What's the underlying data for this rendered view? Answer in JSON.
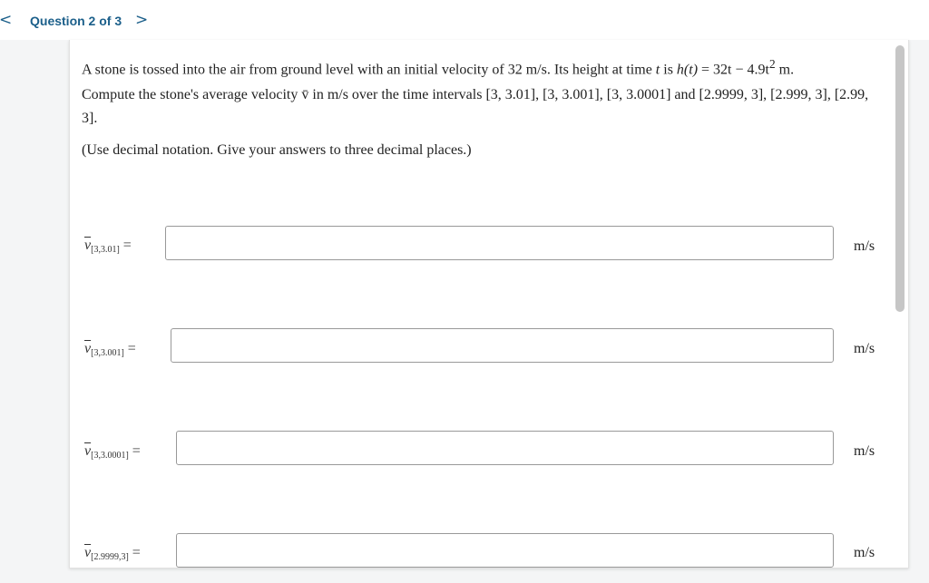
{
  "nav": {
    "prev_glyph": "<",
    "title": "Question 2 of 3",
    "next_glyph": ">"
  },
  "question": {
    "paragraph1_pre": "A stone is tossed into the air from ground level with an initial velocity of 32 m/s. Its height at time ",
    "t_var": "t",
    "is": " is ",
    "h_func": "h(t)",
    "eq_rhs": " = 32t − 4.9t",
    "exp": "2",
    "unit_end": " m.",
    "paragraph2": "Compute the stone's average velocity v̄ in m/s over the time intervals [3, 3.01], [3, 3.001], [3, 3.0001] and [2.9999, 3], [2.999, 3], [2.99, 3].",
    "paragraph3": "(Use decimal notation. Give your answers to three decimal places.)"
  },
  "rows": [
    {
      "var": "v",
      "interval": "[3,3.01]",
      "equals": "=",
      "value": "",
      "unit": "m/s"
    },
    {
      "var": "v",
      "interval": "[3,3.001]",
      "equals": "=",
      "value": "",
      "unit": "m/s"
    },
    {
      "var": "v",
      "interval": "[3,3.0001]",
      "equals": "=",
      "value": "",
      "unit": "m/s"
    },
    {
      "var": "v",
      "interval": "[2.9999,3]",
      "equals": "=",
      "value": "",
      "unit": "m/s"
    }
  ]
}
